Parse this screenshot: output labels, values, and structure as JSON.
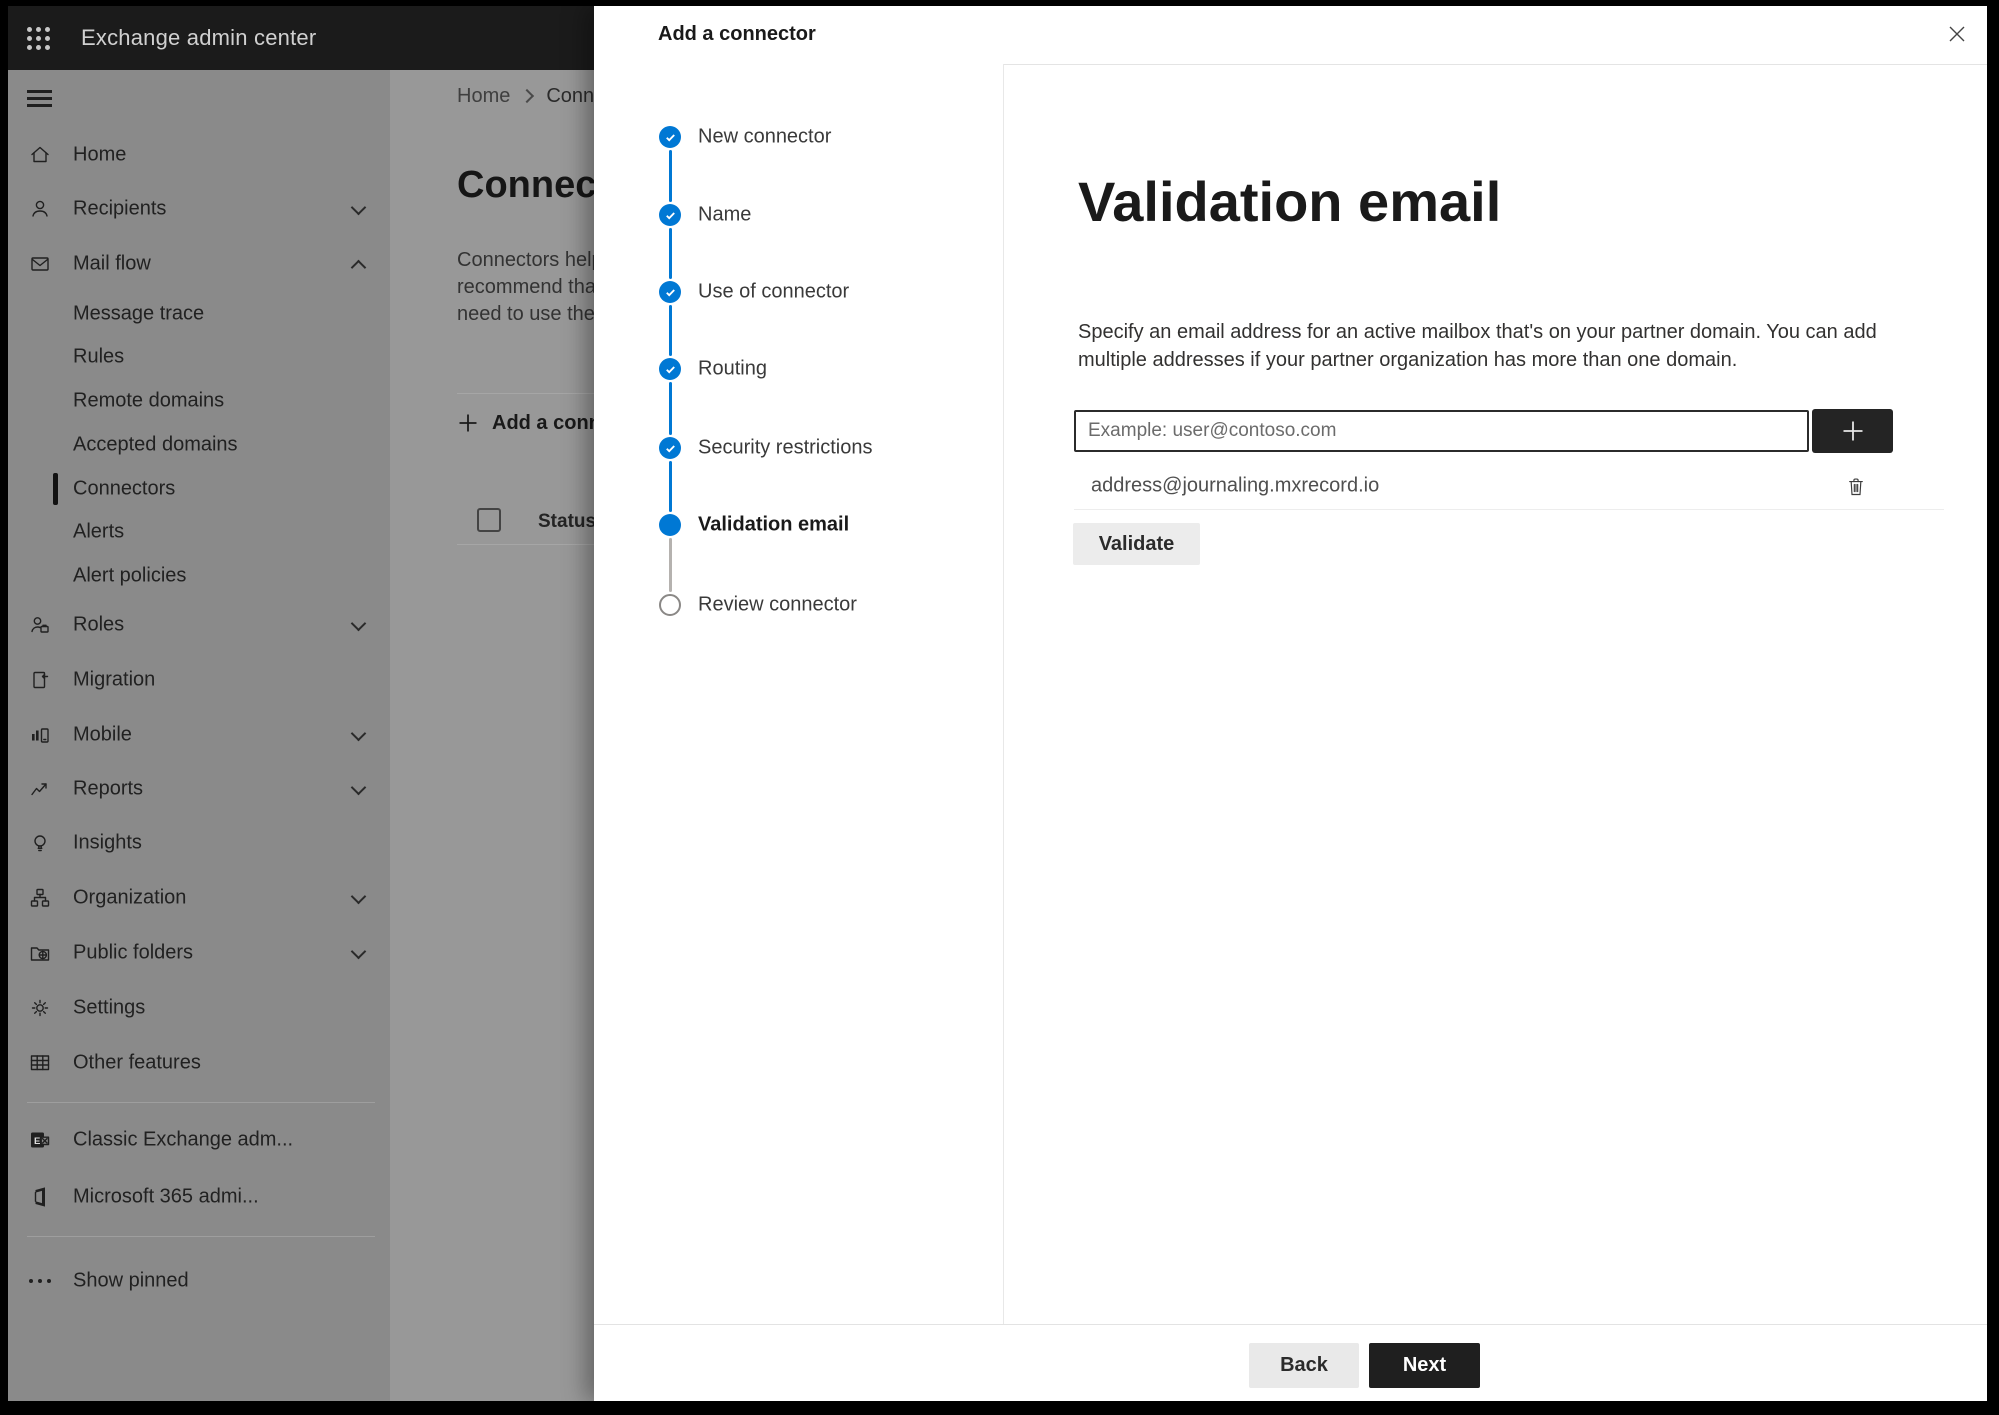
{
  "topbar": {
    "app_title": "Exchange admin center"
  },
  "sidebar": {
    "items": [
      {
        "label": "Home"
      },
      {
        "label": "Recipients"
      },
      {
        "label": "Mail flow"
      },
      {
        "label": "Message trace"
      },
      {
        "label": "Rules"
      },
      {
        "label": "Remote domains"
      },
      {
        "label": "Accepted domains"
      },
      {
        "label": "Connectors"
      },
      {
        "label": "Alerts"
      },
      {
        "label": "Alert policies"
      },
      {
        "label": "Roles"
      },
      {
        "label": "Migration"
      },
      {
        "label": "Mobile"
      },
      {
        "label": "Reports"
      },
      {
        "label": "Insights"
      },
      {
        "label": "Organization"
      },
      {
        "label": "Public folders"
      },
      {
        "label": "Settings"
      },
      {
        "label": "Other features"
      },
      {
        "label": "Classic Exchange adm..."
      },
      {
        "label": "Microsoft 365 admi..."
      },
      {
        "label": "Show pinned"
      }
    ]
  },
  "page": {
    "breadcrumb": {
      "home": "Home",
      "current": "Conne"
    },
    "title": "Connec",
    "description_lines": [
      "Connectors help",
      "recommend tha",
      "need to use ther"
    ],
    "add_button_label": "Add a conn",
    "table": {
      "status_header": "Status"
    }
  },
  "modal": {
    "title": "Add a connector",
    "steps": [
      {
        "label": "New connector",
        "state": "completed"
      },
      {
        "label": "Name",
        "state": "completed"
      },
      {
        "label": "Use of connector",
        "state": "completed"
      },
      {
        "label": "Routing",
        "state": "completed"
      },
      {
        "label": "Security restrictions",
        "state": "completed"
      },
      {
        "label": "Validation email",
        "state": "current"
      },
      {
        "label": "Review connector",
        "state": "upcoming"
      }
    ],
    "content": {
      "heading": "Validation email",
      "description_lines": [
        "Specify an email address for an active mailbox that's on your partner domain. You can add",
        "multiple addresses if your partner organization has more than one domain."
      ],
      "email_input": {
        "placeholder": "Example: user@contoso.com",
        "value": ""
      },
      "addresses": [
        "address@journaling.mxrecord.io"
      ],
      "validate_button": "Validate"
    },
    "footer": {
      "back_button": "Back",
      "next_button": "Next"
    }
  },
  "colors": {
    "accent": "#0078d4",
    "dark_button": "#1f1f1f",
    "topbar": "#1b1b1b",
    "pending_gray": "#8a8886"
  }
}
